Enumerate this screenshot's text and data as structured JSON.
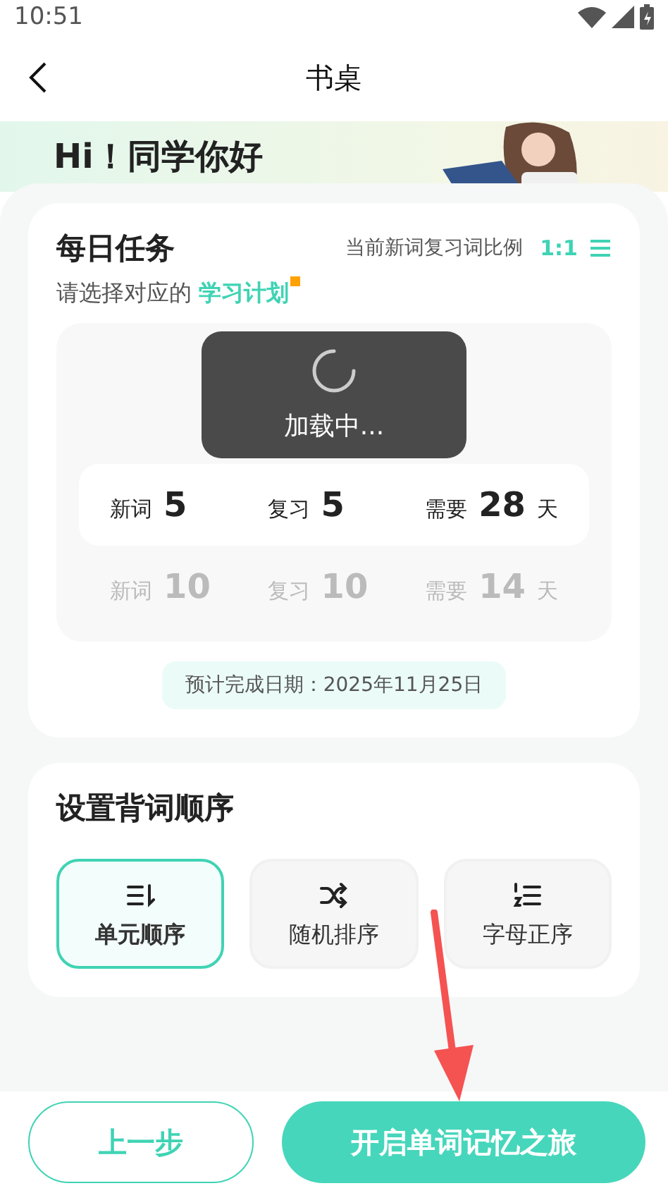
{
  "status_bar": {
    "time": "10:51"
  },
  "header": {
    "title": "书桌"
  },
  "banner": {
    "greeting": "Hi！同学你好"
  },
  "daily_task": {
    "title": "每日任务",
    "ratio_label": "当前新词复习词比例",
    "ratio": "1:1",
    "subtitle": "请选择对应的 **学习计划**",
    "plans": [
      {
        "new_label": "新词",
        "new_count": "5",
        "review_label": "复习",
        "review_count": "5",
        "need_label": "需要",
        "days": "28",
        "days_unit": "天",
        "selected": true
      },
      {
        "new_label": "新词",
        "new_count": "10",
        "review_label": "复习",
        "review_count": "10",
        "need_label": "需要",
        "days": "14",
        "days_unit": "天",
        "selected": false
      }
    ],
    "finish_date": "预计完成日期：2025年11月25日"
  },
  "loading": {
    "text": "加载中..."
  },
  "order": {
    "title": "设置背词顺序",
    "options": [
      {
        "kind": "unit",
        "label": "单元顺序",
        "selected": true
      },
      {
        "kind": "shuffle",
        "label": "随机排序",
        "selected": false
      },
      {
        "kind": "alpha",
        "label": "字母正序",
        "selected": false
      }
    ]
  },
  "footer": {
    "back": "上一步",
    "start": "开启单词记忆之旅"
  }
}
